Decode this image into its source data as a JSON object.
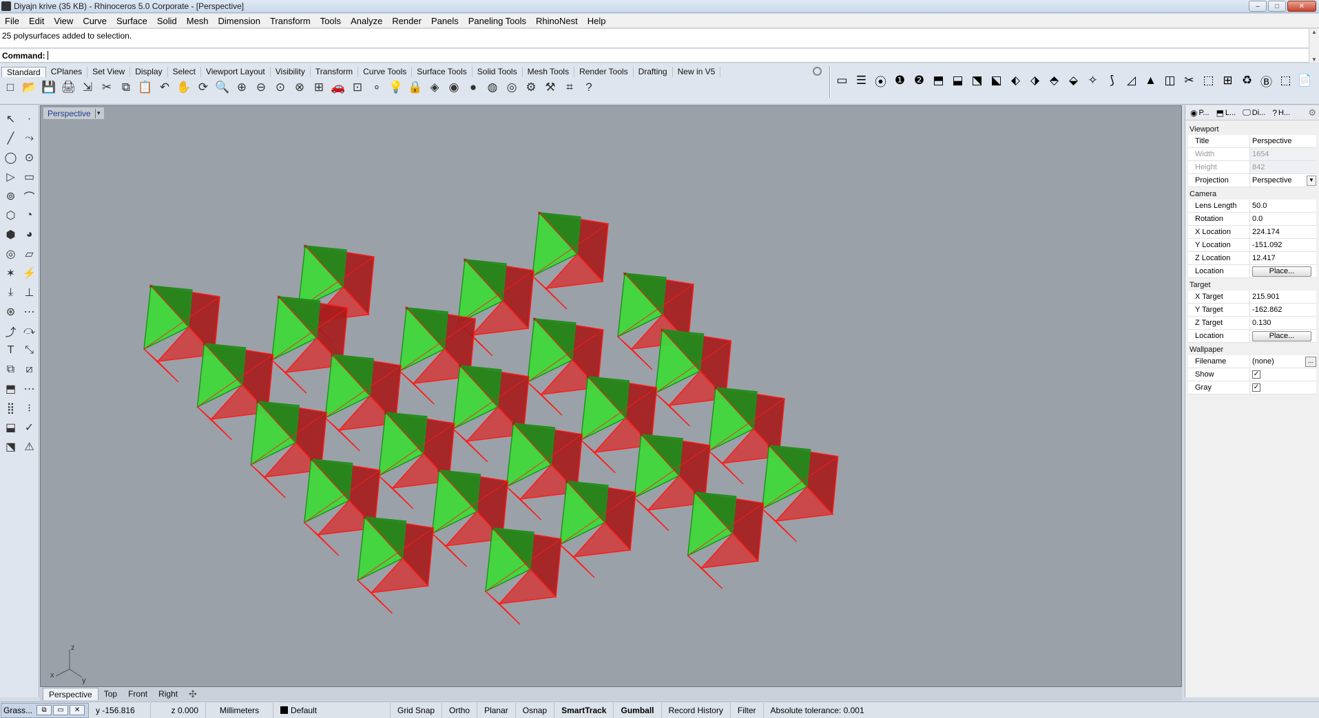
{
  "window": {
    "title": "Diyajn krive (35 KB) - Rhinoceros  5.0 Corporate - [Perspective]",
    "controls": {
      "minimize": "–",
      "maximize": "□",
      "close": "✕"
    }
  },
  "menu": [
    "File",
    "Edit",
    "View",
    "Curve",
    "Surface",
    "Solid",
    "Mesh",
    "Dimension",
    "Transform",
    "Tools",
    "Analyze",
    "Render",
    "Panels",
    "Paneling Tools",
    "RhinoNest",
    "Help"
  ],
  "command": {
    "history": "25 polysurfaces added to selection.",
    "prompt": "Command:",
    "scroll_up": "▲",
    "scroll_down": "▼"
  },
  "toolbar_tabs": [
    "Standard",
    "CPlanes",
    "Set View",
    "Display",
    "Select",
    "Viewport Layout",
    "Visibility",
    "Transform",
    "Curve Tools",
    "Surface Tools",
    "Solid Tools",
    "Mesh Tools",
    "Render Tools",
    "Drafting",
    "New in V5"
  ],
  "toolbar_icons": [
    "new-document-icon",
    "open-icon",
    "save-icon",
    "print-icon",
    "import-icon",
    "cut-icon",
    "copy-icon",
    "paste-icon",
    "undo-icon",
    "pan-icon",
    "rotate-view-icon",
    "zoom-icon",
    "zoom-window-icon",
    "zoom-extents-icon",
    "zoom-selected-icon",
    "zoom-all-icon",
    "four-viewports-icon",
    "car-icon",
    "cplane-icon",
    "point-icon",
    "light-bulb-icon",
    "lock-icon",
    "material-icon",
    "color-wheel-icon",
    "render-sphere-icon",
    "shaded-sphere-icon",
    "rendered-sphere-icon",
    "options-icon",
    "tools-icon",
    "grid-snap-icon",
    "help-icon"
  ],
  "toolbar_glyphs": [
    "□",
    "📂",
    "💾",
    "🖨",
    "⇲",
    "✂",
    "⧉",
    "📋",
    "↶",
    "✋",
    "⟳",
    "🔍",
    "⊕",
    "⊖",
    "⊙",
    "⊗",
    "⊞",
    "🚗",
    "⊡",
    "∘",
    "💡",
    "🔒",
    "◈",
    "◉",
    "●",
    "◍",
    "◎",
    "⚙",
    "⚒",
    "⌗",
    "?"
  ],
  "right_toolbar_glyphs": [
    "▭",
    "☰",
    "⦿",
    "❶",
    "❷",
    "⬒",
    "⬓",
    "⬔",
    "⬕",
    "⬖",
    "⬗",
    "⬘",
    "⬙",
    "✧",
    "⟆",
    "◿",
    "▲",
    "◫",
    "✂",
    "⬚",
    "⊞",
    "♻",
    "Ⓑ",
    "⬚",
    "📄",
    "🖹",
    "📂",
    "?"
  ],
  "left_toolbar_glyphs": [
    "↖",
    "·",
    "╱",
    "⤳",
    "◯",
    "⊙",
    "▷",
    "▭",
    "⊚",
    "⌒",
    "⬡",
    "◔",
    "⬢",
    "◕",
    "◎",
    "▱",
    "✶",
    "⚡",
    "⤓",
    "⊥",
    "⊛",
    "⋯",
    "⤴",
    "⤼",
    "T",
    "⤡",
    "⧉",
    "⧄",
    "⬒",
    "⋯",
    "⣿",
    "⁝",
    "⬓",
    "✓",
    "⬔",
    "⚠"
  ],
  "viewport": {
    "title": "Perspective",
    "caret": "▾",
    "axis_labels": {
      "x": "x",
      "y": "y",
      "z": "z"
    }
  },
  "viewport_tabs": [
    "Perspective",
    "Top",
    "Front",
    "Right"
  ],
  "viewport_tab_add": "✣",
  "panel": {
    "tabs": [
      {
        "icon": "◉",
        "label": "P..."
      },
      {
        "icon": "⬒",
        "label": "L..."
      },
      {
        "icon": "🖵",
        "label": "Di..."
      },
      {
        "icon": "?",
        "label": "H..."
      }
    ],
    "gear": "⚙",
    "sections": {
      "viewport": "Viewport",
      "camera": "Camera",
      "target": "Target",
      "wallpaper": "Wallpaper"
    },
    "viewport_rows": [
      {
        "k": "Title",
        "v": "Perspective"
      },
      {
        "k": "Width",
        "v": "1654"
      },
      {
        "k": "Height",
        "v": "842"
      },
      {
        "k": "Projection",
        "v": "Perspective"
      }
    ],
    "camera_rows": [
      {
        "k": "Lens Length",
        "v": "50.0"
      },
      {
        "k": "Rotation",
        "v": "0.0"
      },
      {
        "k": "X Location",
        "v": "224.174"
      },
      {
        "k": "Y Location",
        "v": "-151.092"
      },
      {
        "k": "Z Location",
        "v": "12.417"
      },
      {
        "k": "Location",
        "v": "Place..."
      }
    ],
    "target_rows": [
      {
        "k": "X Target",
        "v": "215.901"
      },
      {
        "k": "Y Target",
        "v": "-162.862"
      },
      {
        "k": "Z Target",
        "v": "0.130"
      },
      {
        "k": "Location",
        "v": "Place..."
      }
    ],
    "wallpaper_rows": [
      {
        "k": "Filename",
        "v": "(none)"
      },
      {
        "k": "Show",
        "v": "✓"
      },
      {
        "k": "Gray",
        "v": "✓"
      }
    ],
    "dots": "...",
    "dropdown": "▼"
  },
  "status": {
    "grass": "Grass...",
    "mini_buttons": [
      "⧉",
      "▭",
      "✕"
    ],
    "y": "y -156.816",
    "z": "z 0.000",
    "units": "Millimeters",
    "layer": "Default",
    "grid_snap": "Grid Snap",
    "ortho": "Ortho",
    "planar": "Planar",
    "osnap": "Osnap",
    "smarttrack": "SmartTrack",
    "gumball": "Gumball",
    "record_history": "Record History",
    "filter": "Filter",
    "tolerance": "Absolute tolerance: 0.001"
  },
  "colors": {
    "viewport_bg": "#9ba1a8",
    "green_face": "#3fd83a",
    "green_dark": "#1d8f1c",
    "red_face": "#a61c1c",
    "red_light": "#d23a3a",
    "red_edge": "#ff1a1a"
  },
  "scene": {
    "rows": [
      {
        "y": 0,
        "xs": [
          4
        ]
      },
      {
        "y": 1,
        "xs": [
          1,
          3,
          5
        ]
      },
      {
        "y": 2,
        "xs": [
          -1,
          0.6,
          2.2,
          3.8,
          5.4
        ]
      },
      {
        "y": 3,
        "xs": [
          -0.4,
          1.2,
          2.8,
          4.4,
          6.0
        ]
      },
      {
        "y": 4,
        "xs": [
          0.2,
          1.8,
          3.4,
          5.0,
          6.6
        ]
      },
      {
        "y": 5,
        "xs": [
          0.8,
          2.4,
          4.0,
          5.6
        ]
      },
      {
        "y": 6,
        "xs": [
          1.4,
          3.0
        ]
      }
    ]
  }
}
